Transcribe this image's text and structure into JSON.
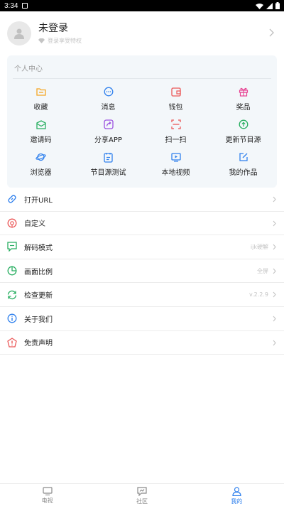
{
  "status_bar": {
    "time": "3:34"
  },
  "profile": {
    "name": "未登录",
    "subtitle": "登录享受特权"
  },
  "personal_center": {
    "title": "个人中心",
    "items": [
      {
        "label": "收藏",
        "icon": "folder-icon",
        "color": "#f5a623"
      },
      {
        "label": "消息",
        "icon": "message-icon",
        "color": "#2f80ed"
      },
      {
        "label": "钱包",
        "icon": "wallet-icon",
        "color": "#eb5757"
      },
      {
        "label": "奖品",
        "icon": "gift-icon",
        "color": "#e84393"
      },
      {
        "label": "邀请码",
        "icon": "envelope-icon",
        "color": "#27ae60"
      },
      {
        "label": "分享APP",
        "icon": "share-icon",
        "color": "#9b51e0"
      },
      {
        "label": "扫一扫",
        "icon": "scan-icon",
        "color": "#eb5757"
      },
      {
        "label": "更新节目源",
        "icon": "update-icon",
        "color": "#27ae60"
      },
      {
        "label": "浏览器",
        "icon": "planet-icon",
        "color": "#2f80ed"
      },
      {
        "label": "节目源测试",
        "icon": "test-icon",
        "color": "#2f80ed"
      },
      {
        "label": "本地视频",
        "icon": "video-icon",
        "color": "#2f80ed"
      },
      {
        "label": "我的作品",
        "icon": "edit-icon",
        "color": "#2f80ed"
      }
    ]
  },
  "menu": [
    {
      "label": "打开URL",
      "value": "",
      "icon": "link-icon",
      "color": "#2f80ed"
    },
    {
      "label": "自定义",
      "value": "",
      "icon": "custom-icon",
      "color": "#eb5757"
    },
    {
      "label": "解码模式",
      "value": "ijk硬解",
      "icon": "decode-icon",
      "color": "#27ae60"
    },
    {
      "label": "画面比例",
      "value": "全屏",
      "icon": "ratio-icon",
      "color": "#27ae60"
    },
    {
      "label": "检查更新",
      "value": "v.2.2.9",
      "icon": "refresh-icon",
      "color": "#27ae60"
    },
    {
      "label": "关于我们",
      "value": "",
      "icon": "info-icon",
      "color": "#2f80ed"
    },
    {
      "label": "免责声明",
      "value": "",
      "icon": "warning-icon",
      "color": "#eb5757"
    }
  ],
  "tabs": [
    {
      "label": "电视",
      "icon": "tv-icon",
      "active": false
    },
    {
      "label": "社区",
      "icon": "community-icon",
      "active": false
    },
    {
      "label": "我的",
      "icon": "profile-icon",
      "active": true
    }
  ],
  "colors": {
    "accent": "#2f80ed",
    "card_bg": "#f3f7fa"
  }
}
